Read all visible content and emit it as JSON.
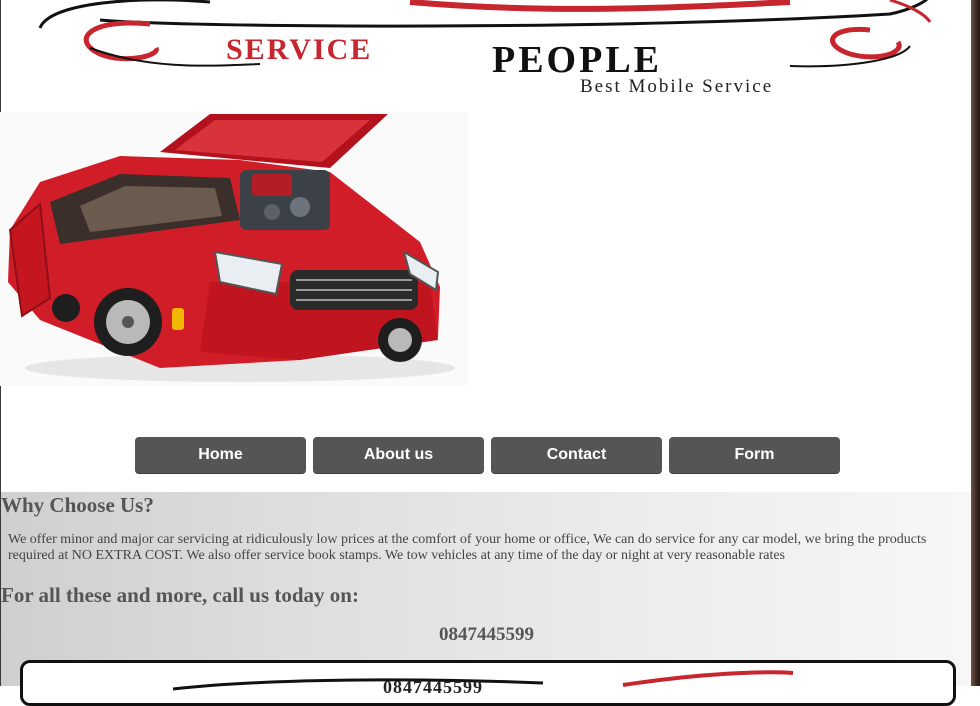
{
  "logo": {
    "word1": "SERVICE",
    "word2": "PEOPLE",
    "tagline": "Best Mobile Service",
    "brand_red": "#c8262e",
    "brand_black": "#111111"
  },
  "hero": {
    "icon": "car-engine-image"
  },
  "nav": {
    "home": "Home",
    "about": "About us",
    "contact": "Contact",
    "form": "Form"
  },
  "why": {
    "title": "Why Choose Us?",
    "text": "We offer minor and major car servicing at ridiculously low prices at the comfort of your home or office, We can do service for any car model, we bring the products required at NO EXTRA COST. We also offer service book stamps. We tow vehicles at any time of the day or night at very reasonable rates"
  },
  "call": {
    "title": "For all these and more, call us today on:",
    "phone": "0847445599"
  },
  "footer": {
    "phone": "0847445599"
  }
}
